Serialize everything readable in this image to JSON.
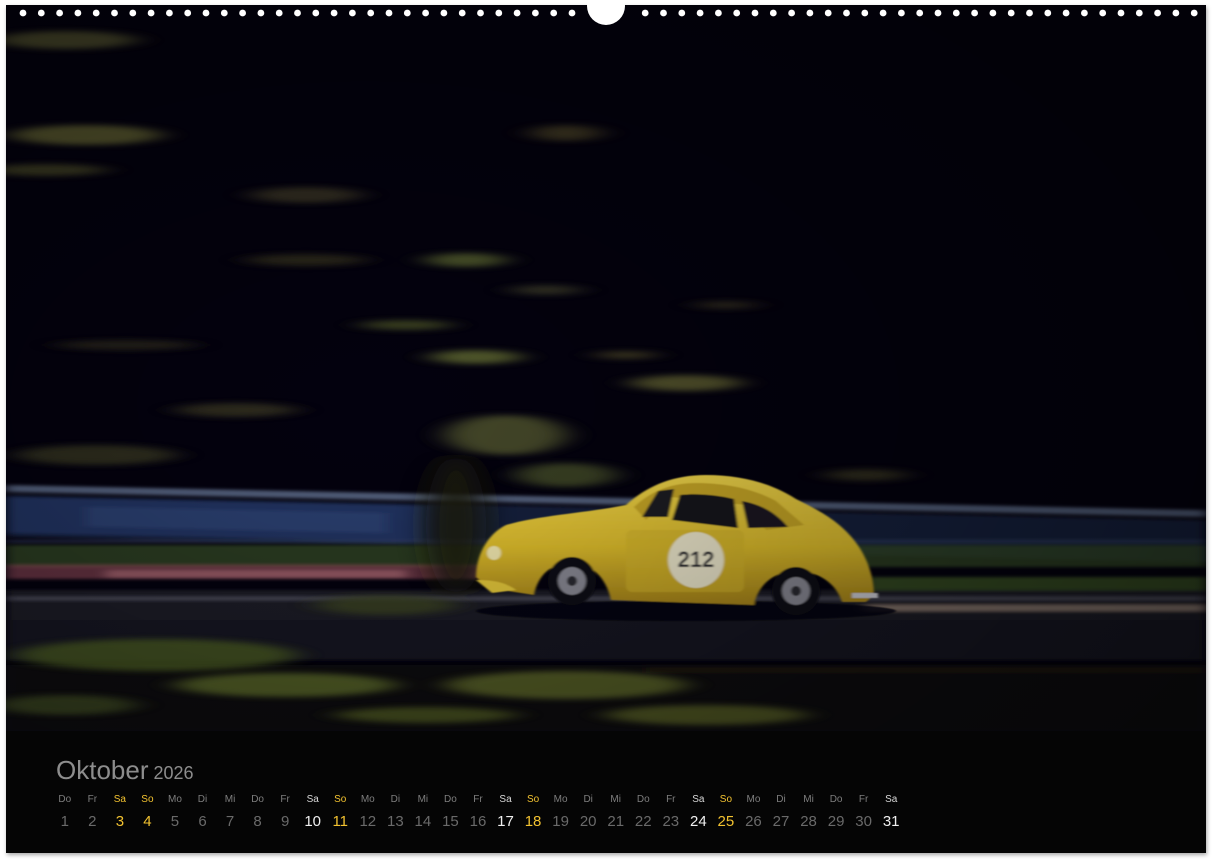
{
  "calendar": {
    "month": "Oktober",
    "year": "2026",
    "days": [
      {
        "weekday": "Do",
        "date": "1",
        "kind": "weekday"
      },
      {
        "weekday": "Fr",
        "date": "2",
        "kind": "weekday"
      },
      {
        "weekday": "Sa",
        "date": "3",
        "kind": "so"
      },
      {
        "weekday": "So",
        "date": "4",
        "kind": "so"
      },
      {
        "weekday": "Mo",
        "date": "5",
        "kind": "weekday"
      },
      {
        "weekday": "Di",
        "date": "6",
        "kind": "weekday"
      },
      {
        "weekday": "Mi",
        "date": "7",
        "kind": "weekday"
      },
      {
        "weekday": "Do",
        "date": "8",
        "kind": "weekday"
      },
      {
        "weekday": "Fr",
        "date": "9",
        "kind": "weekday"
      },
      {
        "weekday": "Sa",
        "date": "10",
        "kind": "sa"
      },
      {
        "weekday": "So",
        "date": "11",
        "kind": "so"
      },
      {
        "weekday": "Mo",
        "date": "12",
        "kind": "weekday"
      },
      {
        "weekday": "Di",
        "date": "13",
        "kind": "weekday"
      },
      {
        "weekday": "Mi",
        "date": "14",
        "kind": "weekday"
      },
      {
        "weekday": "Do",
        "date": "15",
        "kind": "weekday"
      },
      {
        "weekday": "Fr",
        "date": "16",
        "kind": "weekday"
      },
      {
        "weekday": "Sa",
        "date": "17",
        "kind": "sa"
      },
      {
        "weekday": "So",
        "date": "18",
        "kind": "so"
      },
      {
        "weekday": "Mo",
        "date": "19",
        "kind": "weekday"
      },
      {
        "weekday": "Di",
        "date": "20",
        "kind": "weekday"
      },
      {
        "weekday": "Mi",
        "date": "21",
        "kind": "weekday"
      },
      {
        "weekday": "Do",
        "date": "22",
        "kind": "weekday"
      },
      {
        "weekday": "Fr",
        "date": "23",
        "kind": "weekday"
      },
      {
        "weekday": "Sa",
        "date": "24",
        "kind": "sa"
      },
      {
        "weekday": "So",
        "date": "25",
        "kind": "so"
      },
      {
        "weekday": "Mo",
        "date": "26",
        "kind": "weekday"
      },
      {
        "weekday": "Di",
        "date": "27",
        "kind": "weekday"
      },
      {
        "weekday": "Mi",
        "date": "28",
        "kind": "weekday"
      },
      {
        "weekday": "Do",
        "date": "29",
        "kind": "weekday"
      },
      {
        "weekday": "Fr",
        "date": "30",
        "kind": "weekday"
      },
      {
        "weekday": "Sa",
        "date": "31",
        "kind": "sa"
      }
    ]
  },
  "photo": {
    "car_number": "212"
  },
  "colors": {
    "background": "#03010e",
    "car_yellow": "#e2c12e",
    "sunday_highlight": "#f2c230"
  },
  "icons": {
    "binding": "wire-binding-rings"
  }
}
